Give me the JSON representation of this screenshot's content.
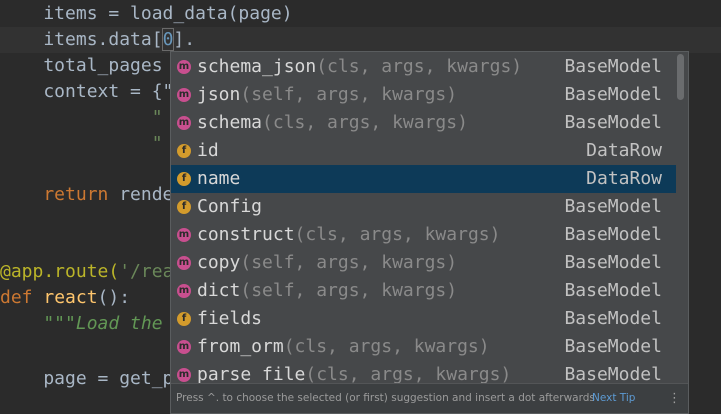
{
  "code": {
    "l1": "    items = load_data(page)",
    "l2_pre": "    items.data[",
    "l2_num": "0",
    "l2_post": "].",
    "l3": "    total_pages ",
    "l4": "    context = {\"",
    "l5": "              \"",
    "l6": "              \"",
    "l7_kw": "    return",
    "l7_rest": " rende",
    "l8_dec": "@app.route(",
    "l8_str": "'/rea",
    "l9_kw": "def",
    "l9_fn": " react",
    "l9_rest": "():",
    "l10": "    \"\"\"Load the",
    "l11": "    page = get_p"
  },
  "completion": {
    "items": [
      {
        "icon": "m",
        "name": "schema_json",
        "params": "(cls, args, kwargs)",
        "type": "BaseModel"
      },
      {
        "icon": "m",
        "name": "json",
        "params": "(self, args, kwargs)",
        "type": "BaseModel"
      },
      {
        "icon": "m",
        "name": "schema",
        "params": "(cls, args, kwargs)",
        "type": "BaseModel"
      },
      {
        "icon": "f",
        "name": "id",
        "params": "",
        "type": "DataRow"
      },
      {
        "icon": "f",
        "name": "name",
        "params": "",
        "type": "DataRow"
      },
      {
        "icon": "f",
        "name": "Config",
        "params": "",
        "type": "BaseModel"
      },
      {
        "icon": "m",
        "name": "construct",
        "params": "(cls, args, kwargs)",
        "type": "BaseModel"
      },
      {
        "icon": "m",
        "name": "copy",
        "params": "(self, args, kwargs)",
        "type": "BaseModel"
      },
      {
        "icon": "m",
        "name": "dict",
        "params": "(self, args, kwargs)",
        "type": "BaseModel"
      },
      {
        "icon": "f",
        "name": "fields",
        "params": "",
        "type": "BaseModel"
      },
      {
        "icon": "m",
        "name": "from_orm",
        "params": "(cls, args, kwargs)",
        "type": "BaseModel"
      },
      {
        "icon": "m",
        "name": "parse_file",
        "params": "(cls, args, kwargs)",
        "type": "BaseModel"
      }
    ],
    "selected_index": 4,
    "footer_hint": "Press ^. to choose the selected (or first) suggestion and insert a dot afterwards",
    "next_tip": "Next Tip",
    "more_icon": "⋮"
  }
}
